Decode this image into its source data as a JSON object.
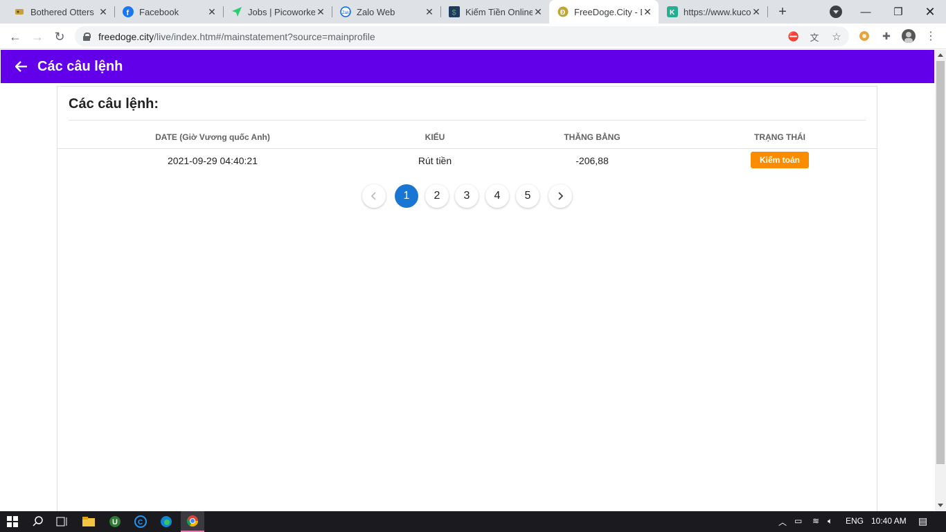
{
  "browser": {
    "tabs": [
      {
        "title": "Bothered Otters",
        "icon": "otter-icon",
        "active": false
      },
      {
        "title": "Facebook",
        "icon": "facebook-icon",
        "active": false
      },
      {
        "title": "Jobs | Picoworkers",
        "icon": "picoworkers-icon",
        "active": false
      },
      {
        "title": "Zalo Web",
        "icon": "zalo-icon",
        "active": false
      },
      {
        "title": "Kiếm Tiền Online",
        "icon": "dollar-icon",
        "active": false
      },
      {
        "title": "FreeDoge.City - D",
        "icon": "doge-icon",
        "active": true
      },
      {
        "title": "https://www.kucoin",
        "icon": "kucoin-icon",
        "active": false
      }
    ],
    "url_domain": "freedoge.city",
    "url_path": "/live/index.htm#/mainstatement?source=mainprofile"
  },
  "appbar": {
    "title": "Các câu lệnh"
  },
  "card": {
    "title": "Các câu lệnh:"
  },
  "table": {
    "headers": [
      "DATE (Giờ Vương quốc Anh)",
      "KIỂU",
      "THĂNG BẰNG",
      "TRẠNG THÁI"
    ],
    "rows": [
      {
        "date": "2021-09-29 04:40:21",
        "type": "Rút tiền",
        "balance": "-206,88",
        "status": "Kiểm toán"
      }
    ]
  },
  "pagination": {
    "pages": [
      "1",
      "2",
      "3",
      "4",
      "5"
    ],
    "current": "1"
  },
  "taskbar": {
    "language": "ENG",
    "time": "10:40 AM"
  },
  "colors": {
    "appbar": "#6200ea",
    "status_badge": "#fb8c00",
    "active_page": "#1976d2"
  }
}
